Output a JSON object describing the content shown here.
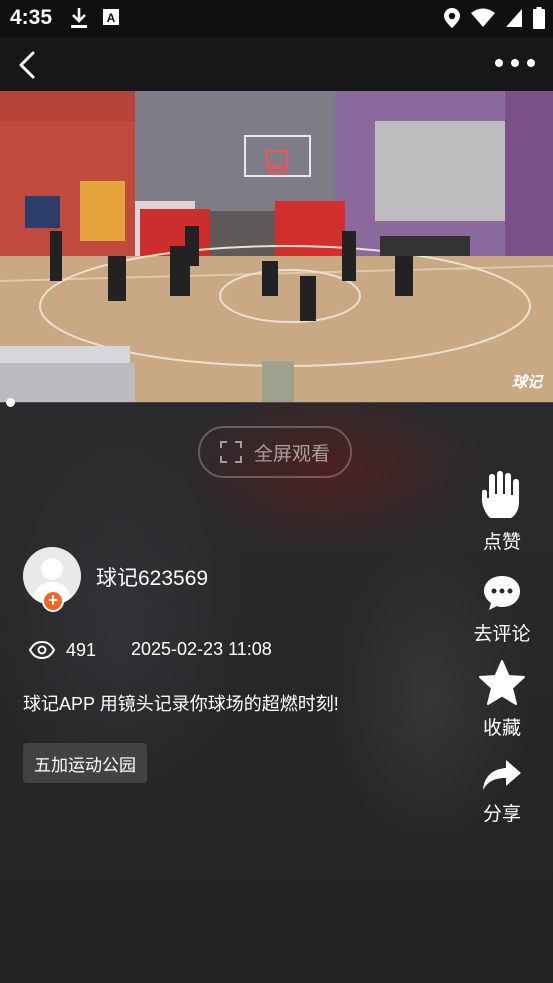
{
  "status_bar": {
    "time": "4:35",
    "left_icons": [
      "download-icon",
      "font-icon"
    ],
    "right_icons": [
      "location-icon",
      "wifi-icon",
      "signal-icon",
      "battery-icon"
    ]
  },
  "top_bar": {
    "back_icon": "chevron-left-icon",
    "more_icon": "more-horizontal-icon"
  },
  "video": {
    "watermark": "球记",
    "progress": 0.0
  },
  "fullscreen": {
    "label": "全屏观看"
  },
  "side_actions": {
    "like": "点赞",
    "comment": "去评论",
    "favorite": "收藏",
    "share": "分享"
  },
  "author": {
    "name": "球记623569",
    "follow_symbol": "+"
  },
  "meta": {
    "views": "491",
    "date": "2025-02-23 11:08"
  },
  "caption": "球记APP 用镜头记录你球场的超燃时刻!",
  "location": "五加运动公园",
  "colors": {
    "accent_orange": "#f26522",
    "background": "#1a1a1c"
  }
}
